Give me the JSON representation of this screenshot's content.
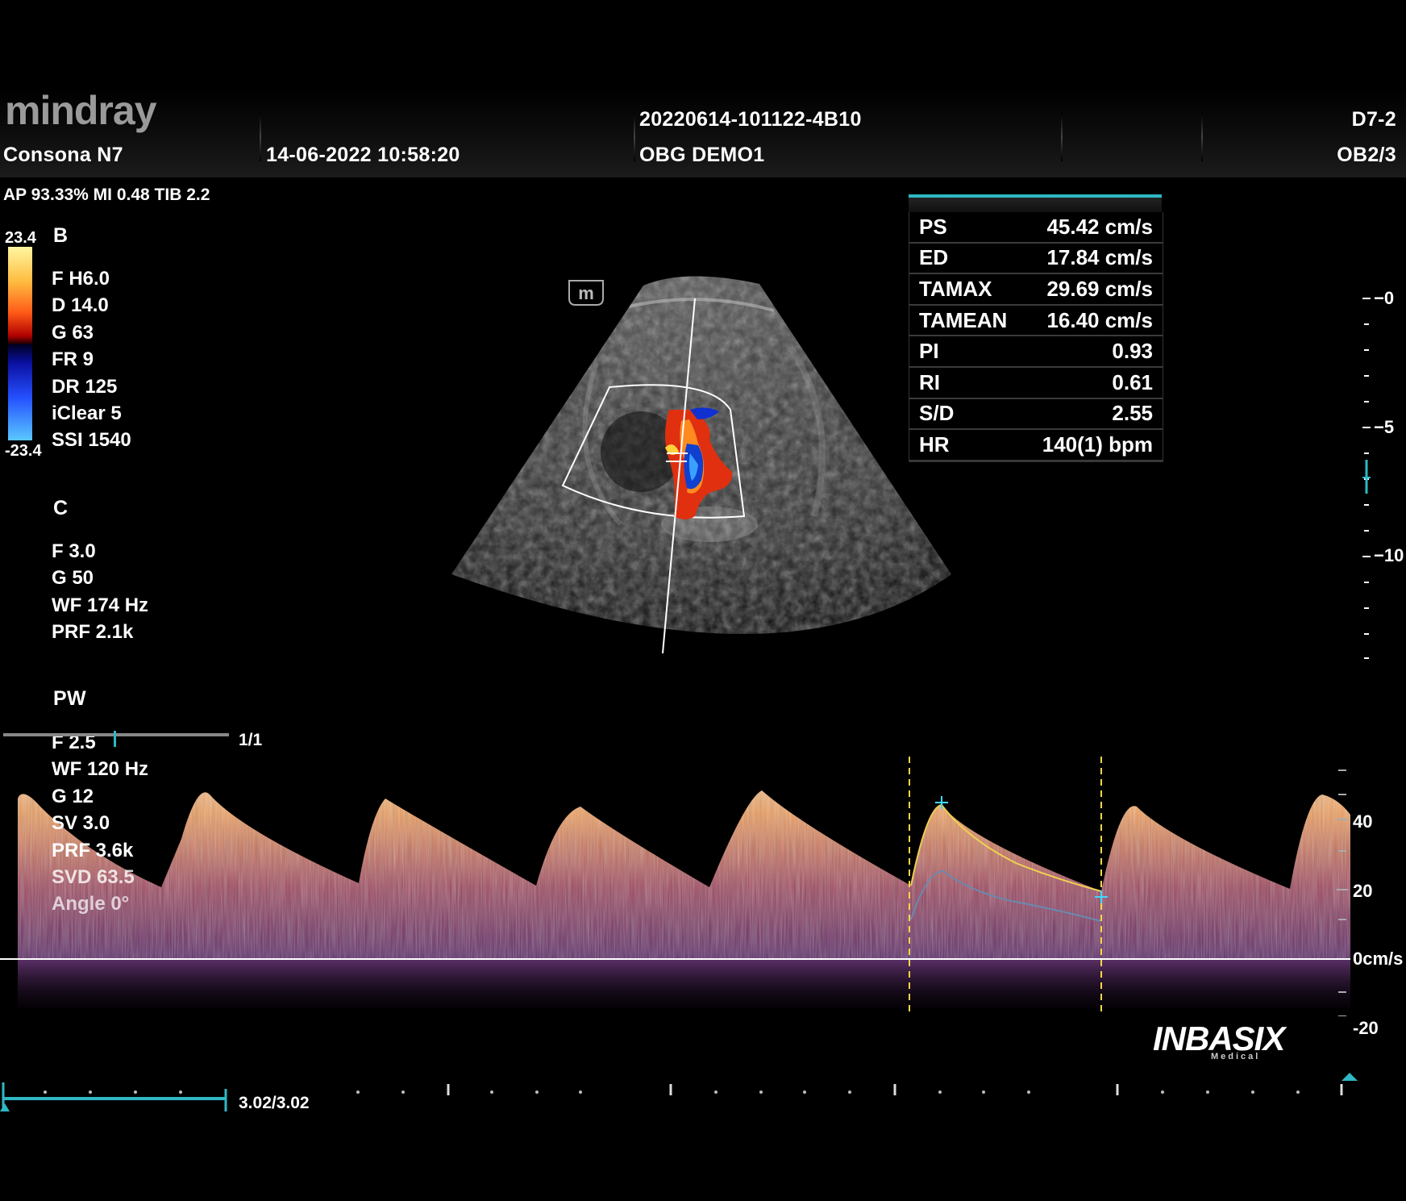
{
  "header": {
    "brand": "mindray",
    "model": "Consona N7",
    "datetime": "14-06-2022  10:58:20",
    "study_id": "20220614-101122-4B10",
    "patient": "OBG DEMO1",
    "probe": "D7-2",
    "preset": "OB2/3",
    "acoustic": "AP 93.33%  MI 0.48 TIB 2.2"
  },
  "color_bar": {
    "max": "23.4",
    "min": "-23.4"
  },
  "b_mode": {
    "title": "B",
    "params": [
      "F H6.0",
      "D 14.0",
      "G 63",
      "FR 9",
      "DR 125",
      "iClear 5",
      "SSI 1540"
    ]
  },
  "c_mode": {
    "title": "C",
    "params": [
      "F 3.0",
      "G 50",
      "WF 174 Hz",
      "PRF 2.1k"
    ]
  },
  "pw_mode": {
    "title": "PW",
    "params": [
      "F 2.5",
      "WF 120 Hz",
      "G 12",
      "SV 3.0",
      "PRF 3.6k",
      "SVD 63.5",
      "Angle    0°"
    ],
    "scroll_count": "1/1"
  },
  "measurements": [
    {
      "label": "PS",
      "value": "45.42 cm/s"
    },
    {
      "label": "ED",
      "value": "17.84 cm/s"
    },
    {
      "label": "TAMAX",
      "value": "29.69 cm/s"
    },
    {
      "label": "TAMEAN",
      "value": "16.40 cm/s"
    },
    {
      "label": "PI",
      "value": "0.93"
    },
    {
      "label": "RI",
      "value": "0.61"
    },
    {
      "label": "S/D",
      "value": "2.55"
    },
    {
      "label": "HR",
      "value": "140(1) bpm"
    }
  ],
  "depth_scale": [
    "0",
    "5",
    "10"
  ],
  "velocity_scale": [
    "40",
    "20",
    "0cm/s",
    "-20"
  ],
  "cine": {
    "frame": "3.02/3.02"
  },
  "watermark": {
    "name": "INBASIX",
    "sub": "Medical"
  },
  "probe_marker": "m",
  "colors": {
    "accent": "#2fb8c4",
    "caliper": "#ffd54a",
    "trace": "#f0d050"
  }
}
